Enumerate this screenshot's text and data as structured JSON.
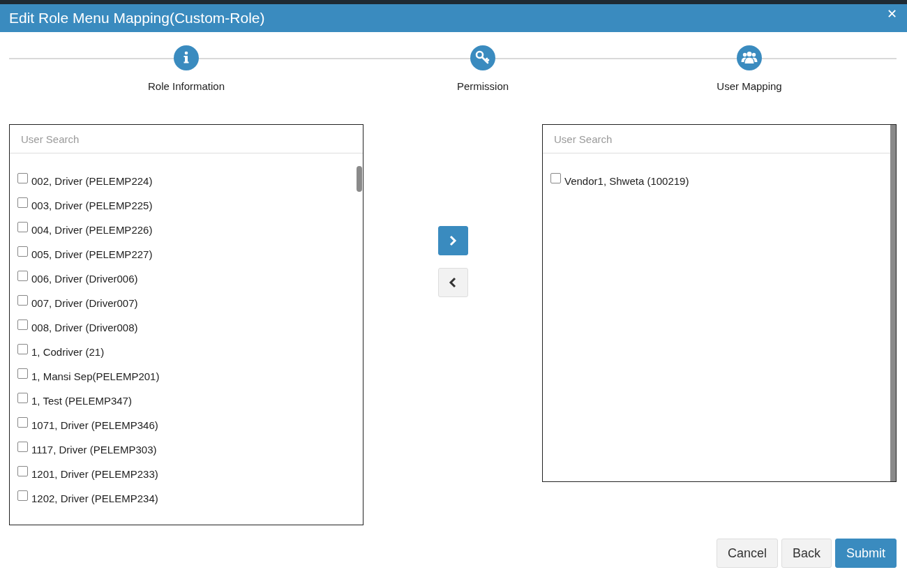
{
  "window": {
    "title": "Edit Role Menu Mapping(Custom-Role)",
    "close": "✕"
  },
  "steps": [
    {
      "label": "Role Information",
      "kind": "info"
    },
    {
      "label": "Permission",
      "kind": "key"
    },
    {
      "label": "User Mapping",
      "kind": "users"
    }
  ],
  "available_users": {
    "search": {
      "placeholder": "User Search"
    },
    "items": [
      {
        "label": "002, Driver (PELEMP224)",
        "checked": false
      },
      {
        "label": "003, Driver (PELEMP225)",
        "checked": false
      },
      {
        "label": "004, Driver (PELEMP226)",
        "checked": false
      },
      {
        "label": "005, Driver (PELEMP227)",
        "checked": false
      },
      {
        "label": "006, Driver (Driver006)",
        "checked": false
      },
      {
        "label": "007, Driver (Driver007)",
        "checked": false
      },
      {
        "label": "008, Driver (Driver008)",
        "checked": false
      },
      {
        "label": "1, Codriver (21)",
        "checked": false
      },
      {
        "label": "1, Mansi Sep(PELEMP201)",
        "checked": false
      },
      {
        "label": "1, Test (PELEMP347)",
        "checked": false
      },
      {
        "label": "1071, Driver (PELEMP346)",
        "checked": false
      },
      {
        "label": "1117, Driver (PELEMP303)",
        "checked": false
      },
      {
        "label": "1201, Driver (PELEMP233)",
        "checked": false
      },
      {
        "label": "1202, Driver (PELEMP234)",
        "checked": false
      }
    ]
  },
  "mapped_users": {
    "search": {
      "placeholder": "User Search"
    },
    "items": [
      {
        "label": "Vendor1, Shweta (100219)",
        "checked": false
      }
    ]
  },
  "buttons": [
    {
      "label": "Cancel",
      "kind": "default"
    },
    {
      "label": "Back",
      "kind": "default"
    },
    {
      "label": "Submit",
      "kind": "primary"
    }
  ]
}
